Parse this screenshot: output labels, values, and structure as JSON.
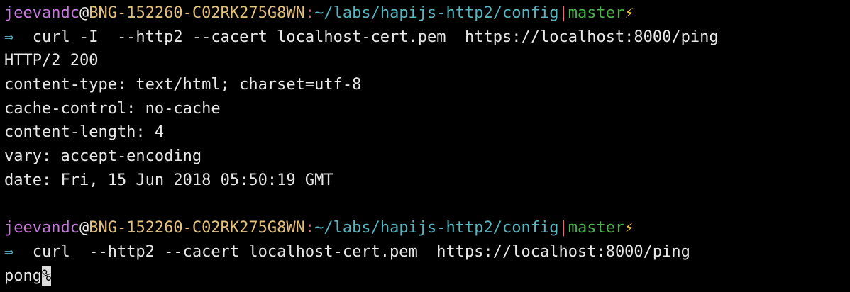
{
  "prompts": [
    {
      "user": "jeevandc",
      "at": "@",
      "host": "BNG-152260-C02RK275G8WN",
      "colon": ":",
      "path": "~/labs/hapijs-http2/config",
      "separator": "|",
      "branch": "master",
      "bolt": "⚡",
      "arrow": "⇒",
      "command": "  curl -I  --http2 --cacert localhost-cert.pem  https://localhost:8000/ping",
      "output": [
        "HTTP/2 200",
        "content-type: text/html; charset=utf-8",
        "cache-control: no-cache",
        "content-length: 4",
        "vary: accept-encoding",
        "date: Fri, 15 Jun 2018 05:50:19 GMT"
      ]
    },
    {
      "user": "jeevandc",
      "at": "@",
      "host": "BNG-152260-C02RK275G8WN",
      "colon": ":",
      "path": "~/labs/hapijs-http2/config",
      "separator": "|",
      "branch": "master",
      "bolt": "⚡",
      "arrow": "⇒",
      "command": "  curl  --http2 --cacert localhost-cert.pem  https://localhost:8000/ping",
      "output_text": "pong",
      "output_marker": "%"
    }
  ]
}
